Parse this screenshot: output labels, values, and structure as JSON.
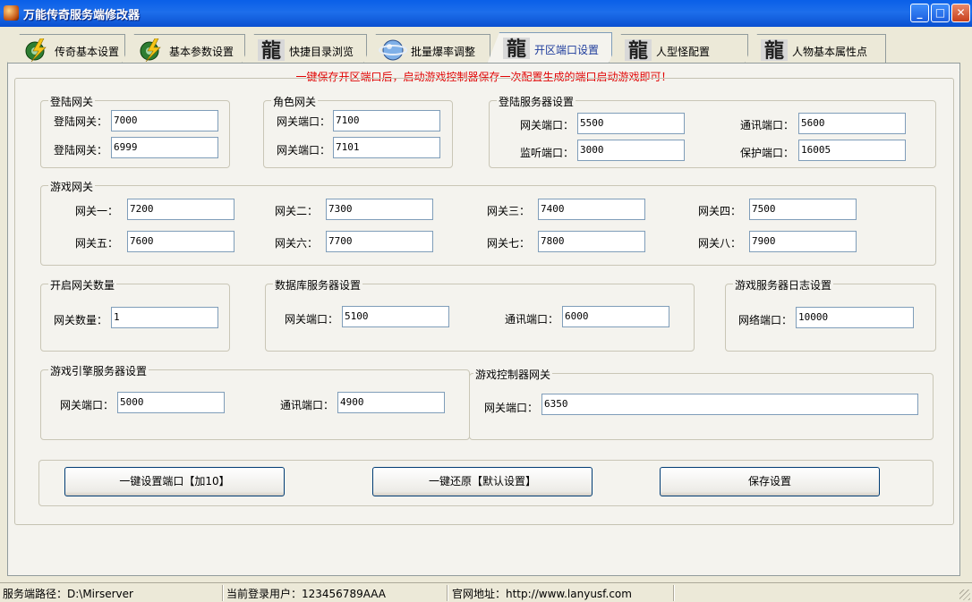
{
  "window": {
    "title": "万能传奇服务端修改器"
  },
  "tabs": [
    {
      "label": "传奇基本设置",
      "icon": "gear-lightning-icon"
    },
    {
      "label": "基本参数设置",
      "icon": "gear-lightning-icon"
    },
    {
      "label": "快捷目录浏览",
      "icon": "dragon-character-icon"
    },
    {
      "label": "批量爆率调整",
      "icon": "globe-icon"
    },
    {
      "label": "开区端口设置",
      "icon": "dragon-character-icon"
    },
    {
      "label": "人型怪配置",
      "icon": "dragon-character-icon"
    },
    {
      "label": "人物基本属性点",
      "icon": "dragon-character-icon"
    }
  ],
  "active_tab": "开区端口设置",
  "notice": "一键保存开区端口后，启动游戏控制器保存一次配置生成的端口启动游戏即可！",
  "login_gate": {
    "title": "登陆网关",
    "label1": "登陆网关：",
    "value1": "7000",
    "label2": "登陆网关：",
    "value2": "6999"
  },
  "role_gate": {
    "title": "角色网关",
    "label1": "网关端口：",
    "value1": "7100",
    "label2": "网关端口：",
    "value2": "7101"
  },
  "login_server": {
    "title": "登陆服务器设置",
    "gate_label": "网关端口：",
    "gate_value": "5500",
    "comm_label": "通讯端口：",
    "comm_value": "5600",
    "listen_label": "监听端口：",
    "listen_value": "3000",
    "protect_label": "保护端口：",
    "protect_value": "16005"
  },
  "game_gate": {
    "title": "游戏网关",
    "gates": [
      {
        "label": "网关一：",
        "value": "7200"
      },
      {
        "label": "网关二：",
        "value": "7300"
      },
      {
        "label": "网关三：",
        "value": "7400"
      },
      {
        "label": "网关四：",
        "value": "7500"
      },
      {
        "label": "网关五：",
        "value": "7600"
      },
      {
        "label": "网关六：",
        "value": "7700"
      },
      {
        "label": "网关七：",
        "value": "7800"
      },
      {
        "label": "网关八：",
        "value": "7900"
      }
    ]
  },
  "gate_count": {
    "title": "开启网关数量",
    "label": "网关数量：",
    "value": "1"
  },
  "db_server": {
    "title": "数据库服务器设置",
    "gate_label": "网关端口：",
    "gate_value": "5100",
    "comm_label": "通讯端口：",
    "comm_value": "6000"
  },
  "log_server": {
    "title": "游戏服务器日志设置",
    "label": "网络端口：",
    "value": "10000"
  },
  "engine_server": {
    "title": "游戏引擎服务器设置",
    "gate_label": "网关端口：",
    "gate_value": "5000",
    "comm_label": "通讯端口：",
    "comm_value": "4900"
  },
  "controller_gate": {
    "title": "游戏控制器网关",
    "label": "网关端口：",
    "value": "6350"
  },
  "buttons": {
    "set_ports": "一键设置端口【加10】",
    "restore": "一键还原【默认设置】",
    "save": "保存设置"
  },
  "statusbar": {
    "path": "服务端路径：D:\\Mirserver",
    "user": "当前登录用户：123456789AAA",
    "site": "官网地址：http://www.lanyusf.com"
  }
}
